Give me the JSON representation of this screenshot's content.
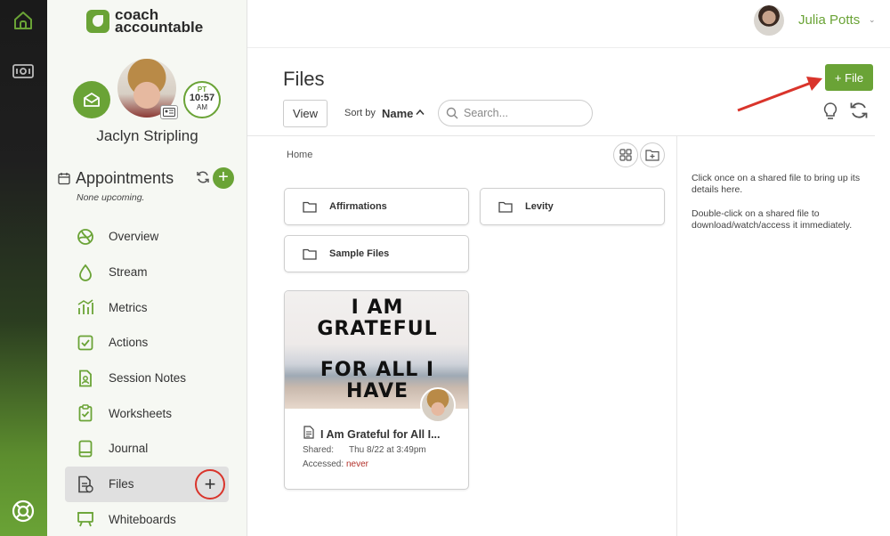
{
  "app": {
    "logo_line1": "coach",
    "logo_line2": "accountable"
  },
  "user": {
    "name": "Julia Potts",
    "caret": "⌄"
  },
  "client": {
    "name": "Jaclyn Stripling",
    "time_zone": "PT",
    "time": "10:57",
    "ampm": "AM"
  },
  "appointments": {
    "title": "Appointments",
    "subtitle": "None upcoming.",
    "add": "+"
  },
  "nav": {
    "items": [
      {
        "label": "Overview",
        "icon": "overview-icon"
      },
      {
        "label": "Stream",
        "icon": "stream-drop-icon"
      },
      {
        "label": "Metrics",
        "icon": "metrics-icon"
      },
      {
        "label": "Actions",
        "icon": "actions-check-icon"
      },
      {
        "label": "Session Notes",
        "icon": "session-notes-icon"
      },
      {
        "label": "Worksheets",
        "icon": "worksheets-icon"
      },
      {
        "label": "Journal",
        "icon": "journal-icon"
      },
      {
        "label": "Files",
        "icon": "files-icon",
        "active": true
      },
      {
        "label": "Whiteboards",
        "icon": "whiteboard-icon"
      }
    ],
    "files_add": "+"
  },
  "files": {
    "title": "Files",
    "add_button": "+ File",
    "view_label": "View",
    "sort_by_label": "Sort by",
    "sort_value": "Name",
    "search_placeholder": "Search...",
    "breadcrumb": "Home",
    "folders": [
      "Affirmations",
      "Levity",
      "Sample Files"
    ],
    "file_card": {
      "thumb_lines": [
        "I AM",
        "GRATEFUL",
        "FOR ALL I",
        "HAVE"
      ],
      "title": "I Am Grateful for All I...",
      "shared_label": "Shared:",
      "shared_value": "Thu 8/22 at 3:49pm",
      "accessed_label": "Accessed:",
      "accessed_value": "never"
    },
    "details_hint": [
      "Click once on a shared file to bring up its details here.",
      "Double-click on a shared file to download/watch/access it immediately."
    ]
  },
  "colors": {
    "brand_green": "#6aa336",
    "annotation_red": "#d9342b",
    "never_red": "#b2302a"
  }
}
